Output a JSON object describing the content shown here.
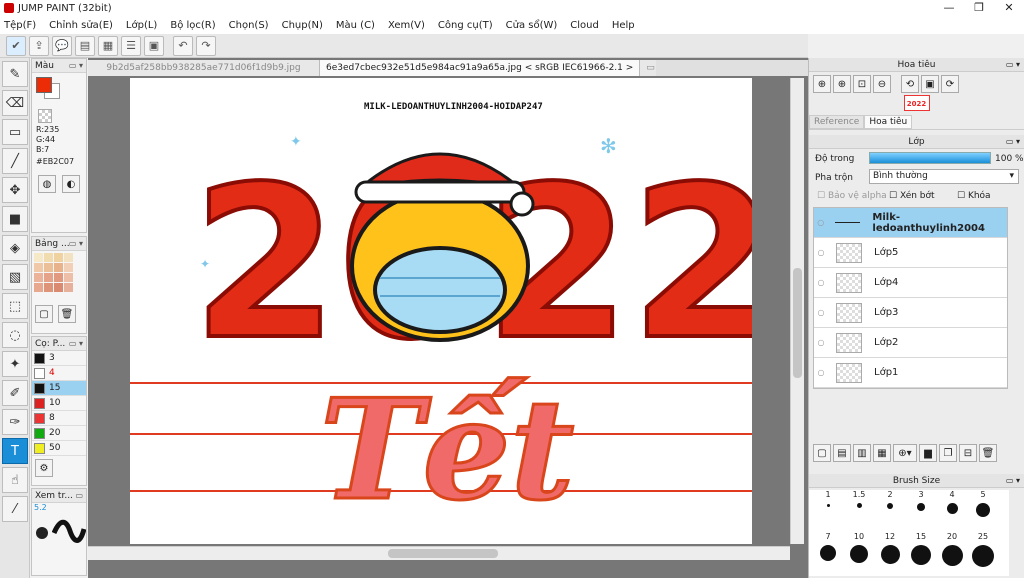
{
  "window": {
    "title": "JUMP PAINT (32bit)",
    "minimize": "—",
    "maximize": "❐",
    "close": "✕"
  },
  "menu": [
    "Tệp(F)",
    "Chỉnh sửa(E)",
    "Lớp(L)",
    "Bộ lọc(R)",
    "Chọn(S)",
    "Chụp(N)",
    "Màu (C)",
    "Xem(V)",
    "Công cụ(T)",
    "Cửa sổ(W)",
    "Cloud",
    "Help"
  ],
  "tabs": [
    "9b2d5af258bb938285ae771d06f1d9b9.jpg",
    "6e3ed7cbec932e51d5e984ac91a9a65a.jpg < sRGB IEC61966-2.1 >"
  ],
  "colors": {
    "accent": "#1a8fd8",
    "foreground": "#EB2C07"
  },
  "color_panel": {
    "title": "Màu",
    "r": "R:235",
    "g": "G:44",
    "b": "B:7",
    "hex": "#EB2C07"
  },
  "palette_panel": {
    "title": "Bảng ..."
  },
  "size_panel": {
    "title": "Cọ: P...",
    "items": [
      "3",
      "4",
      "15",
      "10",
      "8",
      "20",
      "50"
    ]
  },
  "preview_panel": {
    "title": "Xem tr...",
    "value": "5.2"
  },
  "artwork": {
    "watermark": "MILK-LEDOANTHUYLINH2004-HOIDAP247",
    "year": "2022",
    "word": "Tết"
  },
  "navigator": {
    "title": "Hoa tiêu",
    "tab_reference": "Reference",
    "tab_navigator": "Hoa tiêu"
  },
  "layer_panel": {
    "title": "Lớp",
    "opacity_label": "Độ trong",
    "opacity_value": "100 %",
    "opacity": 1.0,
    "blend_label": "Pha trộn",
    "blend_value": "Bình thường",
    "protect_alpha": "Bảo vệ alpha",
    "clip": "Xén bớt",
    "lock": "Khóa",
    "layers": [
      {
        "name": "Milk-ledoanthuylinh2004",
        "selected": true
      },
      {
        "name": "Lớp5",
        "selected": false
      },
      {
        "name": "Lớp4",
        "selected": false
      },
      {
        "name": "Lớp3",
        "selected": false
      },
      {
        "name": "Lớp2",
        "selected": false
      },
      {
        "name": "Lớp1",
        "selected": false
      }
    ]
  },
  "brush_panel": {
    "title": "Brush Size",
    "sizes_row1": [
      "1",
      "1.5",
      "2",
      "3",
      "4",
      "5"
    ],
    "sizes_row2": [
      "7",
      "10",
      "12",
      "15",
      "20",
      "25"
    ]
  }
}
